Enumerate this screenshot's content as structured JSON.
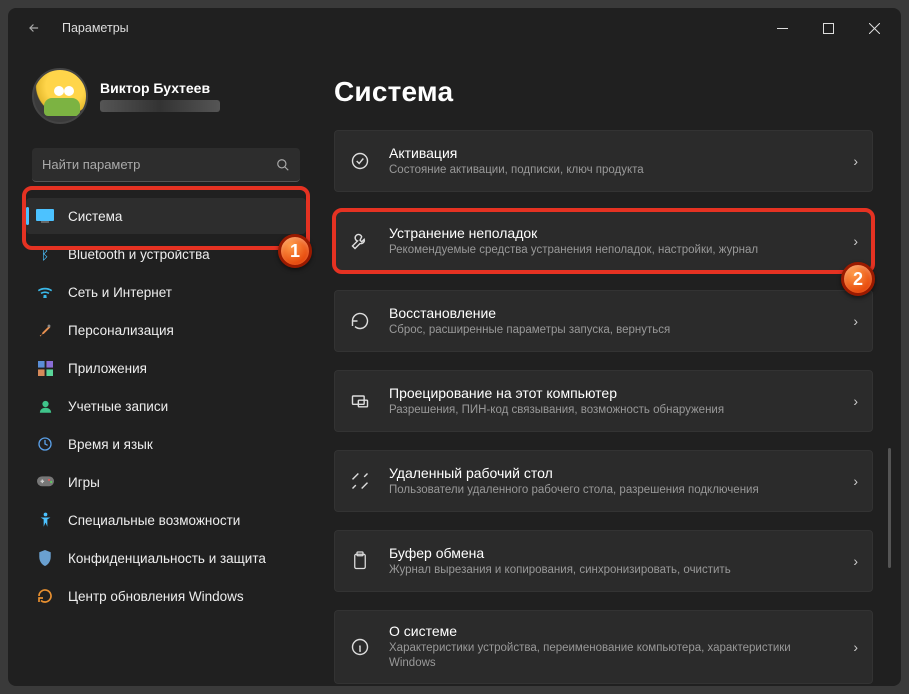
{
  "window": {
    "title": "Параметры"
  },
  "profile": {
    "name": "Виктор Бухтеев"
  },
  "search": {
    "placeholder": "Найти параметр"
  },
  "sidebar": {
    "items": [
      {
        "label": "Система"
      },
      {
        "label": "Bluetooth и устройства"
      },
      {
        "label": "Сеть и Интернет"
      },
      {
        "label": "Персонализация"
      },
      {
        "label": "Приложения"
      },
      {
        "label": "Учетные записи"
      },
      {
        "label": "Время и язык"
      },
      {
        "label": "Игры"
      },
      {
        "label": "Специальные возможности"
      },
      {
        "label": "Конфиденциальность и защита"
      },
      {
        "label": "Центр обновления Windows"
      }
    ]
  },
  "main": {
    "heading": "Система",
    "cards": [
      {
        "title": "Активация",
        "sub": "Состояние активации, подписки, ключ продукта"
      },
      {
        "title": "Устранение неполадок",
        "sub": "Рекомендуемые средства устранения неполадок, настройки, журнал"
      },
      {
        "title": "Восстановление",
        "sub": "Сброс, расширенные параметры запуска, вернуться"
      },
      {
        "title": "Проецирование на этот компьютер",
        "sub": "Разрешения, ПИН-код связывания, возможность обнаружения"
      },
      {
        "title": "Удаленный рабочий стол",
        "sub": "Пользователи удаленного рабочего стола, разрешения подключения"
      },
      {
        "title": "Буфер обмена",
        "sub": "Журнал вырезания и копирования, синхронизировать, очистить"
      },
      {
        "title": "О системе",
        "sub": "Характеристики устройства, переименование компьютера, характеристики Windows"
      }
    ]
  },
  "annotations": {
    "badge1": "1",
    "badge2": "2"
  }
}
